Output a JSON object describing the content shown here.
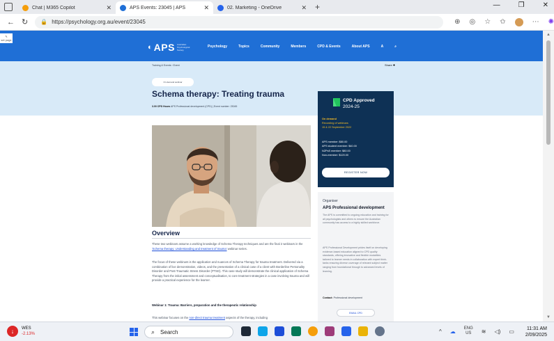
{
  "browser": {
    "tabs": [
      {
        "label": "Chat | M365 Copilot",
        "active": false,
        "color": "#f59e0b"
      },
      {
        "label": "APS Events: 23045 | APS",
        "active": true,
        "color": "#1f6fd6"
      },
      {
        "label": "02. Marketing - OneDrive",
        "active": false,
        "color": "#2563eb"
      }
    ],
    "url": "https://psychology.org.au/event/23045"
  },
  "site": {
    "logo": "APS",
    "logo_tagline": "Australian Psychological Society",
    "nav": [
      "Psychology",
      "Topics",
      "Community",
      "Members",
      "CPD & Events",
      "About APS"
    ],
    "account": "A",
    "brand_color": "#1f6fd6"
  },
  "event": {
    "breadcrumb": "Training & Events › Event",
    "share": "Share",
    "format_pill": "On demand webinar",
    "title": "Schema therapy: Treating trauma",
    "cpd_hours_label": "3.00 CPD Hours",
    "cpd_meta": "APS Professional development (CPD) | Event number: 23045"
  },
  "overview": {
    "heading": "Overview",
    "p1": "These two webinars assume a working knowledge of Schema Therapy techniques and are the final 2 webinars in the",
    "p1_link": "'Schema therapy: Understanding and treatment of trauma'",
    "p1_end": "webinar series.",
    "p2": "The focus of these webinars is the application and nuances of Schema Therapy for trauma treatment. Delivered via a combination of live demonstration, videos, and the presentation of a clinical case of a client with Borderline Personality Disorder and Post-Traumatic Stress Disorder (PTSD). This case study will demonstrate the clinical application of Schema Therapy from the initial assessment and conceptualisation, to core treatment strategies in a case involving trauma and will provide a practical experience for the learner.",
    "webinar1_heading": "Webinar 1: Trauma: Barriers, preparation and the therapeutic relationship",
    "p3": "This webinar focuses on the",
    "p3_link": "non-direct trauma treatment",
    "p3_end": "aspects of the therapy, including"
  },
  "cpd_card": {
    "title": "CPD Approved",
    "year": "2024-25",
    "on_demand": "On demand",
    "recording": "Recording of webinars",
    "dates": "15 & 22 September 2022",
    "prices": [
      "APS member: $80.00",
      "APS student member: $40.00",
      "NZPsS member: $80.00",
      "Non-member: $120.00"
    ],
    "register_label": "REGISTER NOW"
  },
  "organiser": {
    "label": "Organiser",
    "name": "APS Professional development",
    "p1": "The APS is committed to ongoing education and training for all psychologists and others to ensure the Australian community has access to a highly skilled workforce.",
    "p2": "APS Professional Development prides itself on developing evidence-based education aligned to CPD quality standards, offering innovative and flexible modalities tailored to learner needs in collaboration with expert think-tanks ensuring diverse coverage of relevant subject matter ranging from foundational through to advanced levels of learning.",
    "contact_label": "Contact:",
    "contact_value": "Professional development",
    "button_label": "EMAIL CPD"
  },
  "taskbar": {
    "weather_name": "WES",
    "weather_change": "-2.13%",
    "search_label": "Search",
    "lang": "ENG",
    "region": "US",
    "time": "11:31 AM",
    "date": "2/09/2025"
  }
}
